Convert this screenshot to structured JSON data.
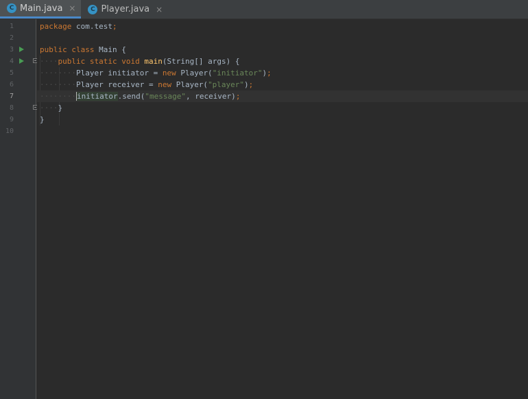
{
  "tabs": [
    {
      "label": "Main.java",
      "icon": "class-icon",
      "active": true
    },
    {
      "label": "Player.java",
      "icon": "class-icon",
      "active": false
    }
  ],
  "close_glyph": "×",
  "class_glyph": "C",
  "code": {
    "line_numbers": [
      "1",
      "2",
      "3",
      "4",
      "5",
      "6",
      "7",
      "8",
      "9",
      "10"
    ],
    "current_line": 7,
    "l1": {
      "kw": "package",
      "rest": " com.test",
      "semi": ";"
    },
    "l3": {
      "kw1": "public",
      "kw2": "class",
      "name": " Main {"
    },
    "l4": {
      "kw1": "public",
      "kw2": "static",
      "kw3": "void",
      "fn": "main",
      "rest": "(String[] args) {"
    },
    "l5": {
      "type": "Player ",
      "var": "initiator",
      "eq": " = ",
      "kw": "new",
      "ctor": " Player(",
      "str": "\"initiator\"",
      "end": ")",
      "semi": ";"
    },
    "l6": {
      "type": "Player ",
      "var": "receiver",
      "eq": " = ",
      "kw": "new",
      "ctor": " Player(",
      "str": "\"player\"",
      "end": ")",
      "semi": ";"
    },
    "l7": {
      "var": "initiator",
      "call": ".send(",
      "str": "\"message\"",
      "rest": ", receiver)",
      "semi": ";"
    },
    "l8": {
      "brace": "}"
    },
    "l9": {
      "brace": "}"
    }
  },
  "colors": {
    "keyword": "#cc7832",
    "string": "#6a8759",
    "method": "#ffc66d",
    "text": "#a9b7c6",
    "tab_accent": "#4a88c7",
    "run": "#499c54"
  }
}
